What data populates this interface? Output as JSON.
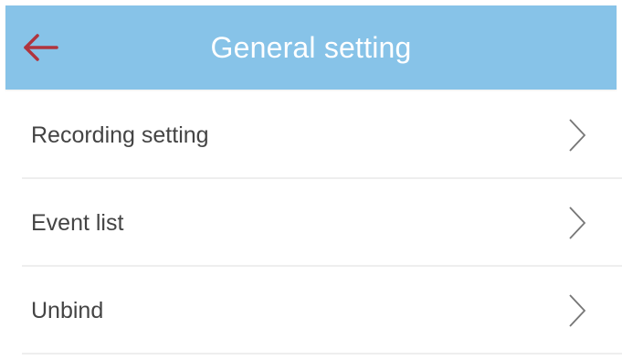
{
  "header": {
    "title": "General setting",
    "back_icon": "arrow-left-icon"
  },
  "colors": {
    "header_background": "#87c3e8",
    "back_arrow": "#b0343e",
    "title_text": "#ffffff",
    "item_text": "#444444",
    "chevron": "#777777",
    "divider": "#eeeeee"
  },
  "menu": {
    "items": [
      {
        "label": "Recording setting",
        "icon": "chevron-right-icon"
      },
      {
        "label": "Event list",
        "icon": "chevron-right-icon"
      },
      {
        "label": "Unbind",
        "icon": "chevron-right-icon"
      }
    ]
  }
}
